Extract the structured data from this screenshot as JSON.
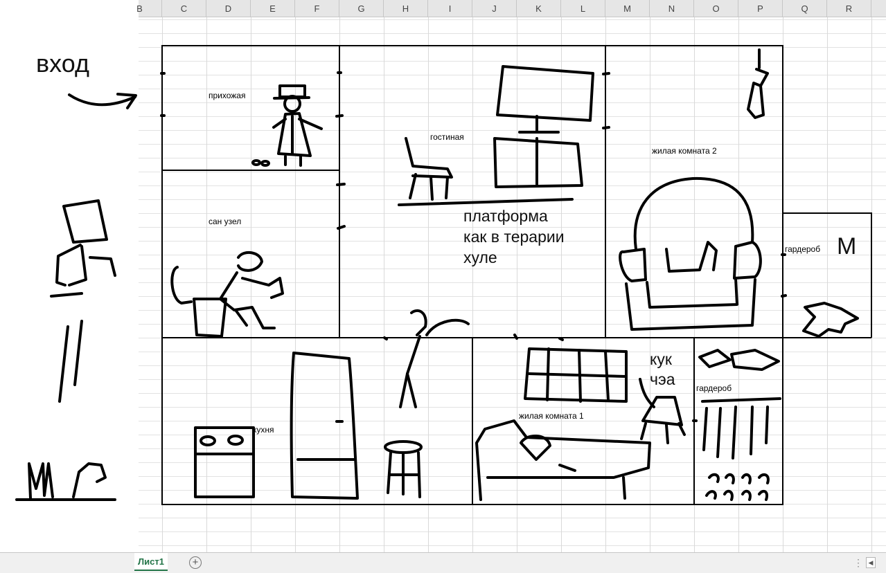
{
  "spreadsheet": {
    "columns": [
      "B",
      "C",
      "D",
      "E",
      "F",
      "G",
      "H",
      "I",
      "J",
      "K",
      "L",
      "M",
      "N",
      "O",
      "P",
      "Q",
      "R"
    ],
    "sheet_tab": "Лист1",
    "add_sheet_symbol": "+",
    "scroll_menu_symbol": "⋮",
    "scroll_left_symbol": "◀"
  },
  "plan": {
    "entry_label": "вход",
    "rooms": {
      "hallway": "прихожая",
      "living_room": "гостиная",
      "bathroom": "сан узел",
      "bedroom_2": "жилая комната 2",
      "wardrobe_1": "гардероб",
      "kitchen": "кухня",
      "bedroom_1": "жилая комната 1",
      "wardrobe_2": "гардероб"
    },
    "platform_note": [
      "платформа",
      "как в терарии",
      "хуле"
    ],
    "kuk_note": [
      "кук",
      "чэа"
    ],
    "wardrobe_letter": "M"
  }
}
